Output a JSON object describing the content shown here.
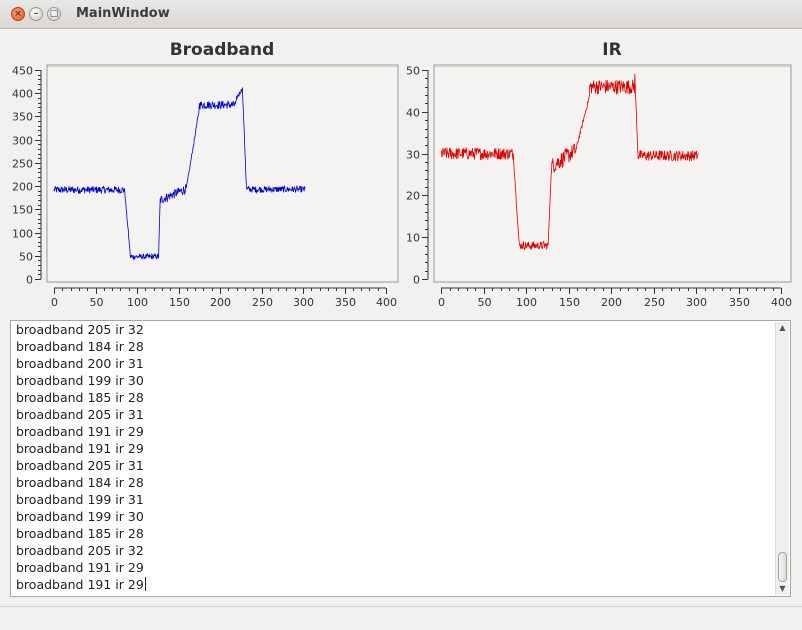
{
  "window": {
    "title": "MainWindow",
    "controls": {
      "close": "×",
      "minimize": "–",
      "maximize": "□"
    }
  },
  "plots": [
    {
      "id": "broadband",
      "title": "Broadband",
      "color": "#0000c8",
      "xlim": [
        0,
        400
      ],
      "ylim": [
        0,
        450
      ],
      "xticks": [
        0,
        50,
        100,
        150,
        200,
        250,
        300,
        350,
        400
      ],
      "yticks": [
        0,
        50,
        100,
        150,
        200,
        250,
        300,
        350,
        400,
        450
      ]
    },
    {
      "id": "ir",
      "title": "IR",
      "color": "#dd0000",
      "xlim": [
        0,
        400
      ],
      "ylim": [
        0,
        50
      ],
      "xticks": [
        0,
        50,
        100,
        150,
        200,
        250,
        300,
        350,
        400
      ],
      "yticks": [
        0,
        10,
        20,
        30,
        40,
        50
      ]
    }
  ],
  "chart_data": [
    {
      "type": "line",
      "title": "Broadband",
      "xlabel": "",
      "ylabel": "",
      "xlim": [
        0,
        400
      ],
      "ylim": [
        0,
        450
      ],
      "grid": false,
      "x_range": [
        0,
        303
      ],
      "segments": [
        {
          "x": [
            0,
            85
          ],
          "y": 192,
          "noise": 8
        },
        {
          "x": [
            85,
            92
          ],
          "y": [
            192,
            50
          ]
        },
        {
          "x": [
            92,
            126
          ],
          "y": 48,
          "noise": 6
        },
        {
          "x": [
            126,
            128
          ],
          "y": [
            48,
            175
          ]
        },
        {
          "x": [
            128,
            160
          ],
          "y": [
            170,
            195
          ],
          "noise": 10
        },
        {
          "x": [
            160,
            175
          ],
          "y": [
            200,
            365
          ]
        },
        {
          "x": [
            175,
            220
          ],
          "y": 375,
          "noise": 9
        },
        {
          "x": [
            220,
            227
          ],
          "y": [
            390,
            410
          ]
        },
        {
          "x": [
            227,
            232
          ],
          "y": [
            410,
            190
          ]
        },
        {
          "x": [
            232,
            303
          ],
          "y": 193,
          "noise": 7
        }
      ]
    },
    {
      "type": "line",
      "title": "IR",
      "xlabel": "",
      "ylabel": "",
      "xlim": [
        0,
        400
      ],
      "ylim": [
        0,
        50
      ],
      "grid": false,
      "x_range": [
        0,
        303
      ],
      "segments": [
        {
          "x": [
            0,
            85
          ],
          "y": 30,
          "noise": 1.5
        },
        {
          "x": [
            85,
            92
          ],
          "y": [
            30,
            8
          ]
        },
        {
          "x": [
            92,
            126
          ],
          "y": 8,
          "noise": 1
        },
        {
          "x": [
            126,
            130
          ],
          "y": [
            8,
            27
          ]
        },
        {
          "x": [
            130,
            160
          ],
          "y": [
            27,
            31
          ],
          "noise": 2
        },
        {
          "x": [
            160,
            175
          ],
          "y": [
            32,
            44
          ]
        },
        {
          "x": [
            175,
            228
          ],
          "y": 46,
          "noise": 1.8
        },
        {
          "x": [
            228,
            232
          ],
          "y": [
            49,
            28
          ]
        },
        {
          "x": [
            232,
            303
          ],
          "y": 29.5,
          "noise": 1.3
        }
      ]
    }
  ],
  "log": {
    "lines": [
      "broadband 205 ir 32",
      "broadband 184 ir 28",
      "broadband 200 ir 31",
      "broadband 199 ir 30",
      "broadband 185 ir 28",
      "broadband 205 ir 31",
      "broadband 191 ir 29",
      "broadband 191 ir 29",
      "broadband 205 ir 31",
      "broadband 184 ir 28",
      "broadband 199 ir 31",
      "broadband 199 ir 30",
      "broadband 185 ir 28",
      "broadband 205 ir 32",
      "broadband 191 ir 29",
      "broadband 191 ir 29"
    ]
  },
  "scrollbar": {
    "up_arrow": "▲",
    "down_arrow": "▼"
  }
}
